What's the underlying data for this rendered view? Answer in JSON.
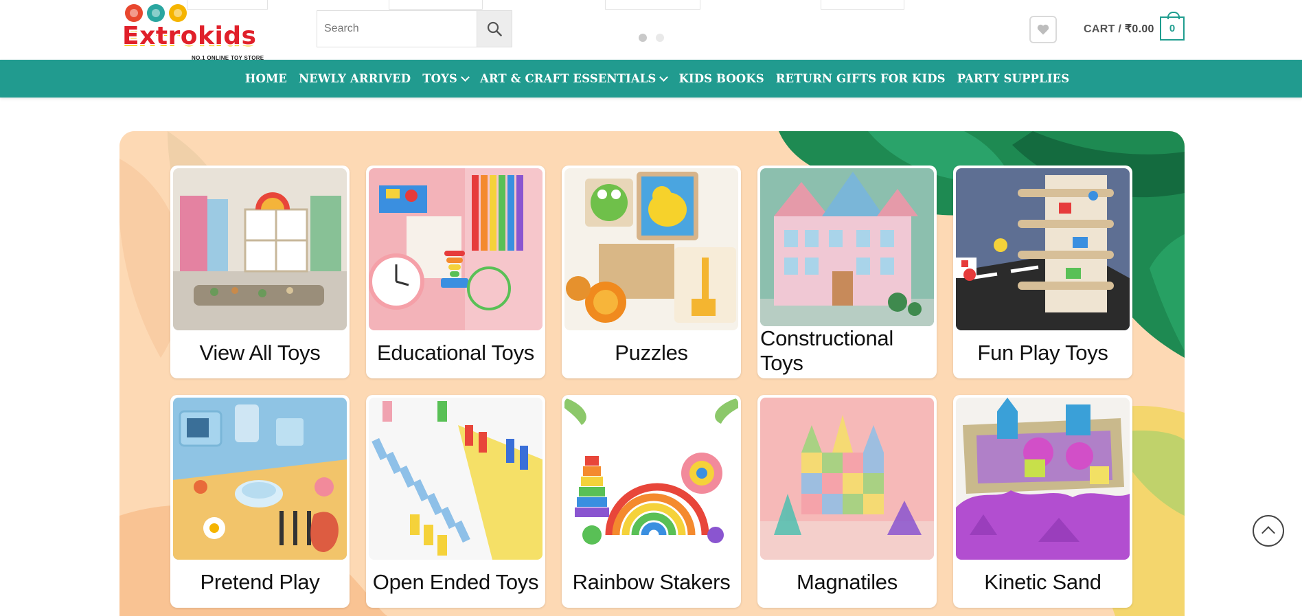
{
  "header": {
    "logo_text": "Extrokids",
    "logo_tagline": "NO.1 ONLINE TOY STORE",
    "logo_dot_colors": [
      "#e8472e",
      "#2aa6a0",
      "#f5b400"
    ],
    "search": {
      "placeholder": "Search"
    },
    "slider_dots": 2,
    "cart": {
      "label": "CART /",
      "amount": "₹0.00",
      "count": "0"
    }
  },
  "nav": {
    "items": [
      {
        "label": "HOME",
        "dropdown": false
      },
      {
        "label": "NEWLY ARRIVED",
        "dropdown": false
      },
      {
        "label": "TOYS",
        "dropdown": true
      },
      {
        "label": "ART & CRAFT ESSENTIALS",
        "dropdown": true
      },
      {
        "label": "KIDS BOOKS",
        "dropdown": false
      },
      {
        "label": "RETURN GIFTS FOR KIDS",
        "dropdown": false
      },
      {
        "label": "PARTY SUPPLIES",
        "dropdown": false
      }
    ]
  },
  "categories": [
    {
      "label": "View All Toys"
    },
    {
      "label": "Educational Toys"
    },
    {
      "label": "Puzzles"
    },
    {
      "label": "Constructional Toys"
    },
    {
      "label": "Fun Play Toys"
    },
    {
      "label": "Pretend Play"
    },
    {
      "label": "Open Ended Toys"
    },
    {
      "label": "Rainbow Stakers"
    },
    {
      "label": "Magnatiles"
    },
    {
      "label": "Kinetic Sand"
    }
  ],
  "colors": {
    "brand_teal": "#219b8f",
    "banner_peach": "#fdd9b4",
    "leaf_green": "#1e8a52",
    "logo_red": "#e0202a",
    "active_dot": "#c9c9c9",
    "inactive_dot": "#e9e9e9"
  },
  "icons": {
    "search": "magnifier-icon",
    "wishlist": "heart-icon",
    "cart": "bag-icon",
    "back_to_top": "chevron-up-icon"
  }
}
